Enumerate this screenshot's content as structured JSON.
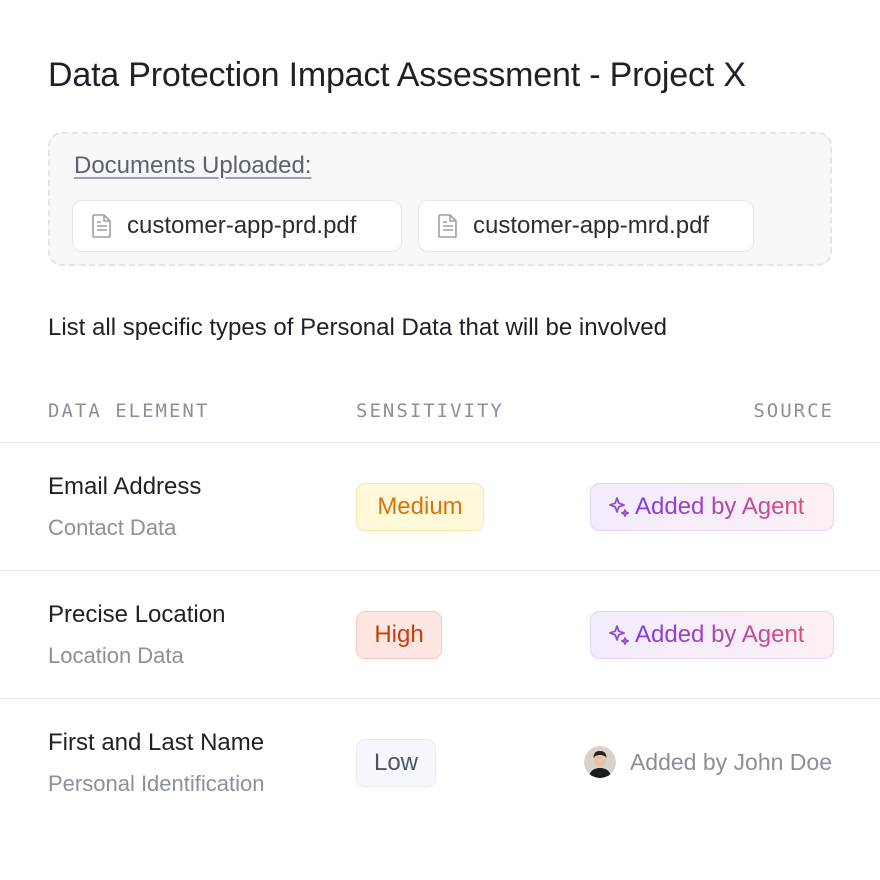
{
  "page": {
    "title": "Data Protection Impact Assessment - Project X"
  },
  "documents": {
    "label": "Documents Uploaded:",
    "files": [
      {
        "name": "customer-app-prd.pdf",
        "icon": "document-icon"
      },
      {
        "name": "customer-app-mrd.pdf",
        "icon": "document-icon"
      }
    ]
  },
  "question": "List all specific types of Personal Data that will be involved",
  "table": {
    "headers": {
      "element": "DATA ELEMENT",
      "sensitivity": "SENSITIVITY",
      "source": "SOURCE"
    },
    "rows": [
      {
        "name": "Email Address",
        "category": "Contact Data",
        "sensitivity": "Medium",
        "source": "Added by Agent",
        "source_type": "agent"
      },
      {
        "name": "Precise Location",
        "category": "Location Data",
        "sensitivity": "High",
        "source": "Added by Agent",
        "source_type": "agent"
      },
      {
        "name": "First and Last Name",
        "category": "Personal Identification",
        "sensitivity": "Low",
        "source": "Added by John Doe",
        "source_type": "user"
      }
    ]
  },
  "colors": {
    "medium": "#d9730d",
    "high": "#c2410c",
    "low": "#4b5563",
    "agent_start": "#7c3aed",
    "agent_end": "#e04f77"
  }
}
